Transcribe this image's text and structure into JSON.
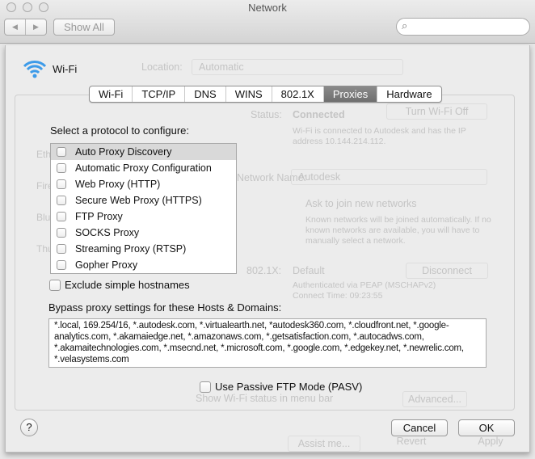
{
  "window": {
    "title": "Network"
  },
  "toolbar": {
    "back": "◀",
    "forward": "▶",
    "show_all": "Show All",
    "search_placeholder": ""
  },
  "background": {
    "service_name": "Wi-Fi",
    "location_label": "Location:",
    "location_value": "Automatic",
    "status_label": "Status:",
    "status_value": "Connected",
    "turn_off": "Turn Wi-Fi Off",
    "status_desc": "Wi-Fi is connected to Autodesk and has the IP address 10.144.214.112.",
    "network_name_label": "Network Name:",
    "network_name_value": "Autodesk",
    "ask_join": "Ask to join new networks",
    "ask_join_desc": "Known networks will be joined automatically. If no known networks are available, you will have to manually select a network.",
    "dot1x_label": "802.1X:",
    "dot1x_value": "Default",
    "disconnect": "Disconnect",
    "auth_desc": "Authenticated via PEAP (MSCHAPv2)",
    "connect_time": "Connect Time: 09:23:55",
    "show_status": "Show Wi-Fi status in menu bar",
    "advanced": "Advanced...",
    "assist": "Assist me...",
    "revert": "Revert",
    "apply": "Apply",
    "sidebar": [
      "Ethernet",
      "FireWire",
      "Bluetooth",
      "Thunderbolt"
    ]
  },
  "tabs": [
    {
      "label": "Wi-Fi",
      "selected": false
    },
    {
      "label": "TCP/IP",
      "selected": false
    },
    {
      "label": "DNS",
      "selected": false
    },
    {
      "label": "WINS",
      "selected": false
    },
    {
      "label": "802.1X",
      "selected": false
    },
    {
      "label": "Proxies",
      "selected": true
    },
    {
      "label": "Hardware",
      "selected": false
    }
  ],
  "proxies": {
    "select_label": "Select a protocol to configure:",
    "protocols": [
      {
        "label": "Auto Proxy Discovery",
        "checked": false
      },
      {
        "label": "Automatic Proxy Configuration",
        "checked": false
      },
      {
        "label": "Web Proxy (HTTP)",
        "checked": false
      },
      {
        "label": "Secure Web Proxy (HTTPS)",
        "checked": false
      },
      {
        "label": "FTP Proxy",
        "checked": false
      },
      {
        "label": "SOCKS Proxy",
        "checked": false
      },
      {
        "label": "Streaming Proxy (RTSP)",
        "checked": false
      },
      {
        "label": "Gopher Proxy",
        "checked": false
      }
    ],
    "exclude_simple": "Exclude simple hostnames",
    "bypass_label": "Bypass proxy settings for these Hosts & Domains:",
    "bypass_value": "*.local, 169.254/16, *.autodesk.com, *.virtualearth.net, *autodesk360.com, *.cloudfront.net, *.google-analytics.com, *.akamaiedge.net, *.amazonaws.com, *.getsatisfaction.com, *.autocadws.com, *.akamaitechnologies.com, *.msecnd.net, *.microsoft.com, *.google.com, *.edgekey.net, *.newrelic.com, *.velasystems.com",
    "passive_ftp": "Use Passive FTP Mode (PASV)"
  },
  "footer": {
    "help": "?",
    "cancel": "Cancel",
    "ok": "OK"
  }
}
